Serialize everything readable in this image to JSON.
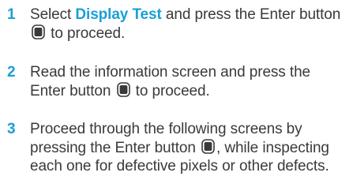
{
  "steps": [
    {
      "number": "1",
      "pre": "Select ",
      "highlight": "Display Test",
      "mid": " and press the Enter button ",
      "post": " to proceed.",
      "icon": "enter-button-icon"
    },
    {
      "number": "2",
      "pre": "Read the information screen and press the Enter button ",
      "post": " to proceed.",
      "icon": "enter-button-icon"
    },
    {
      "number": "3",
      "pre": "Proceed through the following screens by pressing the Enter button ",
      "post": ", while inspecting each one for defective pixels or other defects.",
      "icon": "enter-button-icon"
    }
  ],
  "colors": {
    "accent": "#1a9fd6",
    "text": "#3a3a3a"
  }
}
